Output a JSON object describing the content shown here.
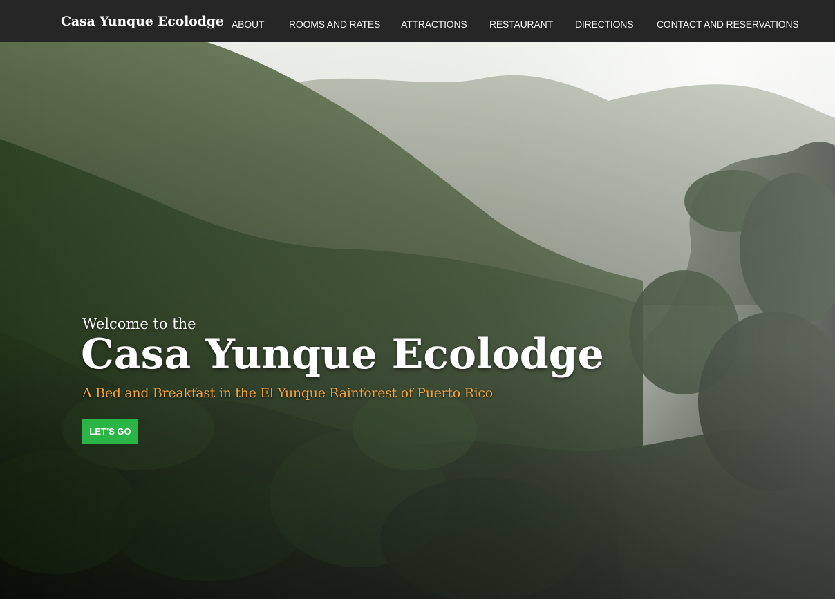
{
  "header": {
    "brand": "Casa Yunque Ecolodge",
    "nav": [
      {
        "label": "ABOUT"
      },
      {
        "label": "ROOMS AND RATES"
      },
      {
        "label": "ATTRACTIONS"
      },
      {
        "label": "RESTAURANT"
      },
      {
        "label": "DIRECTIONS"
      },
      {
        "label": "CONTACT AND RESERVATIONS"
      }
    ]
  },
  "hero": {
    "welcome": "Welcome to the",
    "title": "Casa Yunque Ecolodge",
    "tagline": "A Bed and Breakfast in the El Yunque Rainforest of Puerto Rico",
    "cta_label": "LET'S GO",
    "image_subject": "misty rainforest mountains"
  },
  "colors": {
    "header_bg": "#262626",
    "tagline": "#f0a23f",
    "cta_bg": "#2bb546"
  }
}
